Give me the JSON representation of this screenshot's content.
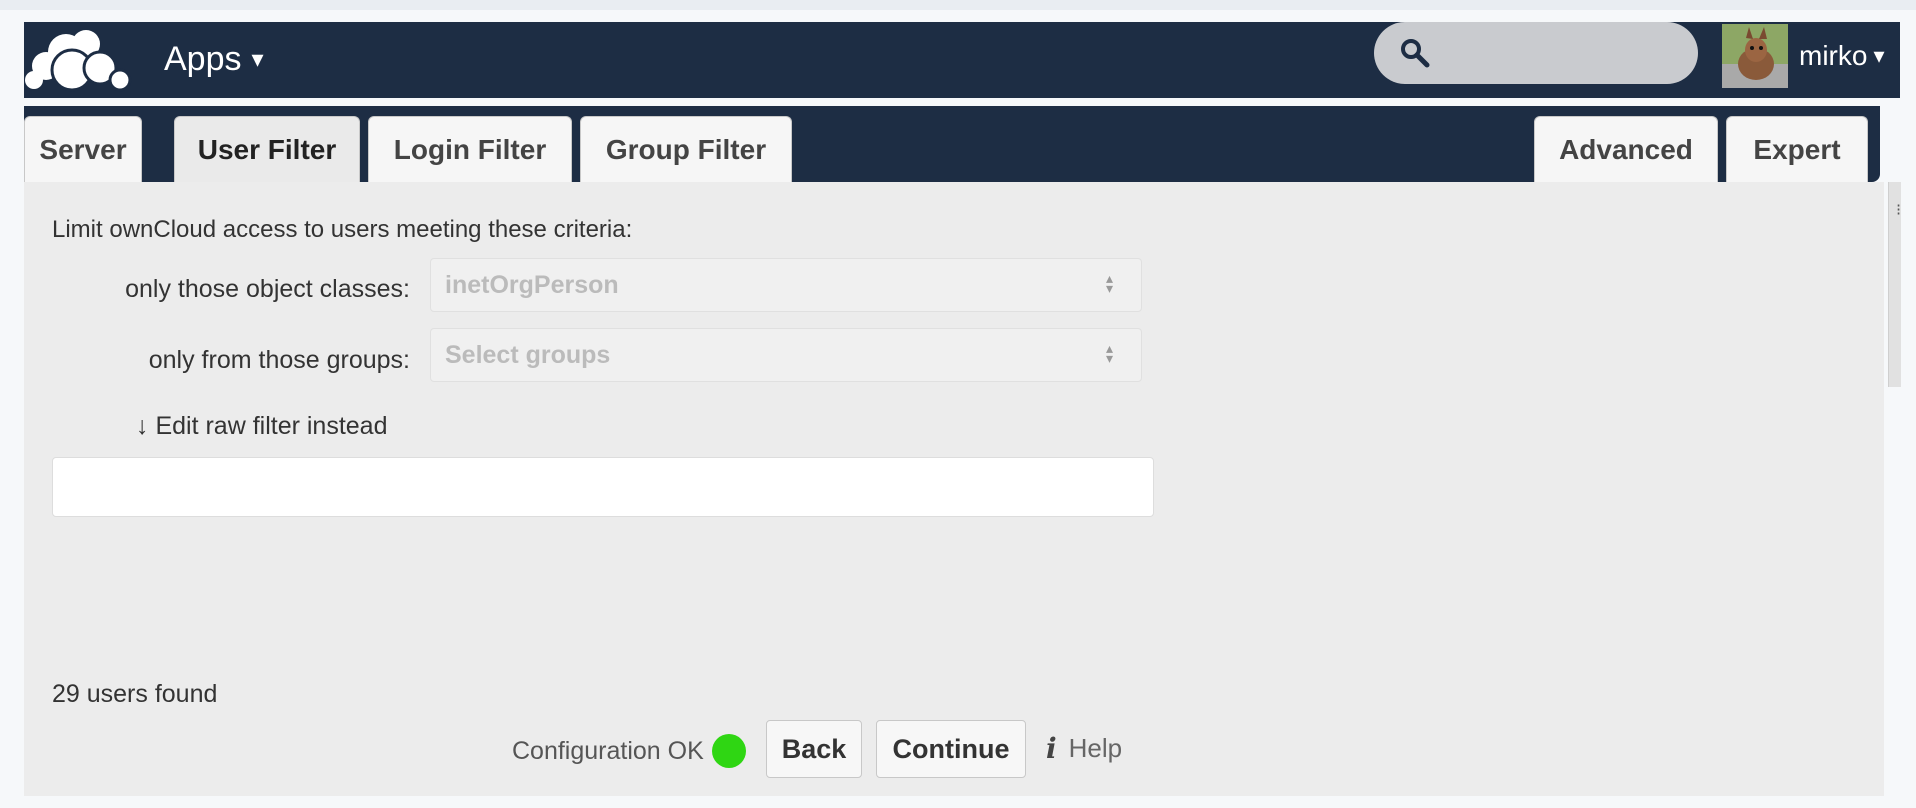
{
  "header": {
    "apps_label": "Apps",
    "caret": "▾",
    "search": {
      "value": "",
      "placeholder": ""
    },
    "user": {
      "name": "mirko"
    }
  },
  "tabs": [
    {
      "label": "Server",
      "active": false
    },
    {
      "label": "User Filter",
      "active": true
    },
    {
      "label": "Login Filter",
      "active": false
    },
    {
      "label": "Group Filter",
      "active": false
    }
  ],
  "right_tabs": [
    {
      "label": "Advanced"
    },
    {
      "label": "Expert"
    }
  ],
  "user_filter": {
    "intro": "Limit ownCloud access to users meeting these criteria:",
    "object_classes": {
      "label": "only those object classes:",
      "value": "inetOrgPerson"
    },
    "groups": {
      "label": "only from those groups:",
      "placeholder": "Select groups"
    },
    "edit_raw": "↓ Edit raw filter instead",
    "raw_filter_value": "",
    "users_found": "29 users found"
  },
  "footer": {
    "status_text": "Configuration OK",
    "status_color": "#2fd613",
    "back_label": "Back",
    "continue_label": "Continue",
    "help_icon": "i",
    "help_label": "Help"
  },
  "colors": {
    "header_bg": "#1d2d44",
    "panel_bg": "#ececec"
  }
}
